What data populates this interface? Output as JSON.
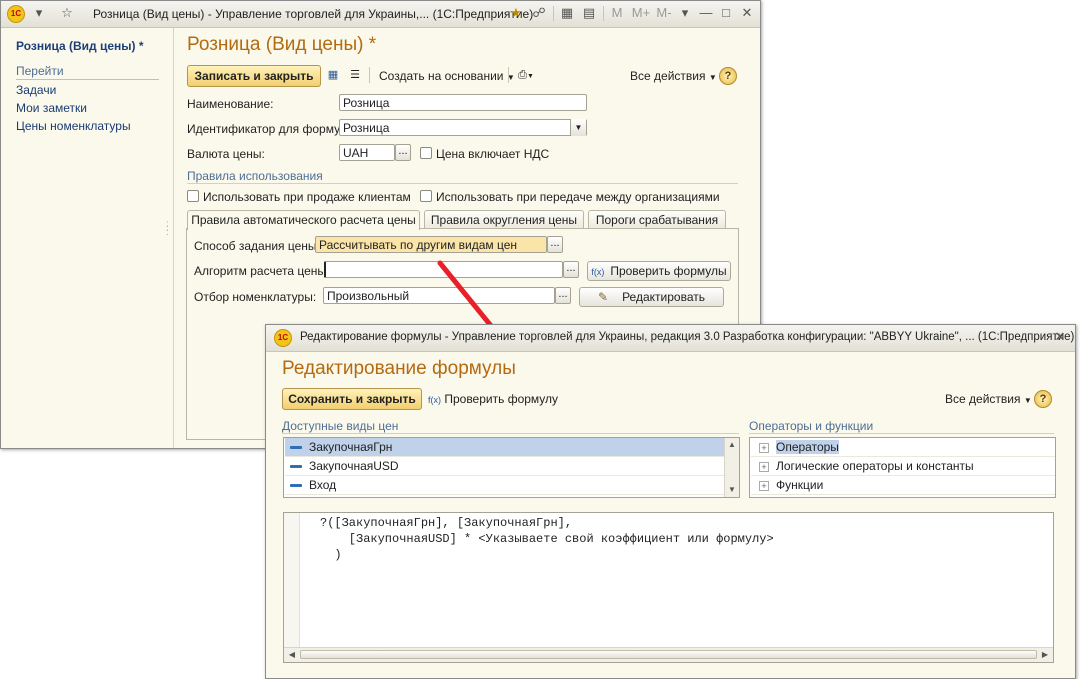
{
  "main_window": {
    "title": "Розница (Вид цены) - Управление торговлей для Украины,... (1С:Предприятие)",
    "logo_text": "1С",
    "titlebar_buttons": [
      "M",
      "M+",
      "M-"
    ],
    "sidebar": {
      "title": "Розница (Вид цены) *",
      "section": "Перейти",
      "links": [
        "Задачи",
        "Мои заметки",
        "Цены номенклатуры"
      ]
    },
    "form_title": "Розница (Вид цены) *",
    "toolbar": {
      "save_close": "Записать и закрыть",
      "create_based": "Создать на основании",
      "all_actions": "Все действия",
      "help": "?"
    },
    "fields": {
      "name_label": "Наименование:",
      "name_value": "Розница",
      "formula_id_label": "Идентификатор для формул:",
      "formula_id_value": "Розница",
      "currency_label": "Валюта цены:",
      "currency_value": "UAH",
      "vat_label": "Цена включает НДС"
    },
    "usage": {
      "title": "Правила использования",
      "sale_label": "Использовать при продаже клиентам",
      "transfer_label": "Использовать при передаче между организациями"
    },
    "tabs": [
      "Правила автоматического расчета цены",
      "Правила округления цены",
      "Пороги срабатывания"
    ],
    "tab_content": {
      "method_label": "Способ задания цены:",
      "method_value": "Рассчитывать по другим видам цен",
      "algorithm_label": "Алгоритм расчета цены:",
      "algorithm_value": "",
      "check_formulas": "Проверить формулы",
      "filter_label": "Отбор номенклатуры:",
      "filter_value": "Произвольный",
      "edit": "Редактировать"
    },
    "ellipsis": "..."
  },
  "formula_window": {
    "title": "Редактирование формулы - Управление торговлей для Украины, редакция 3.0 Разработка конфигурации: \"ABBYY Ukraine\", ...  (1С:Предприятие)",
    "logo_text": "1С",
    "form_title": "Редактирование формулы",
    "toolbar": {
      "save_close": "Сохранить и закрыть",
      "check_formula": "Проверить формулу",
      "all_actions": "Все действия",
      "help": "?"
    },
    "available_prices": {
      "title": "Доступные виды цен",
      "items": [
        "ЗакупочнаяГрн",
        "ЗакупочнаяUSD",
        "Вход"
      ],
      "selected_index": 0
    },
    "operators": {
      "title": "Операторы и функции",
      "items": [
        "Операторы",
        "Логические операторы и константы",
        "Функции"
      ],
      "selected_index": 0
    },
    "formula_lines": [
      "?([ЗакупочнаяГрн], [ЗакупочнаяГрн],",
      "    [ЗакупочнаяUSD] * <Указываете свой коэффициент или формулу>",
      "  )"
    ]
  },
  "colors": {
    "arrow": "#e8202a",
    "form_title": "#b46a10",
    "selection": "#c0d1ea",
    "highlight_field": "#fbe4a8"
  }
}
